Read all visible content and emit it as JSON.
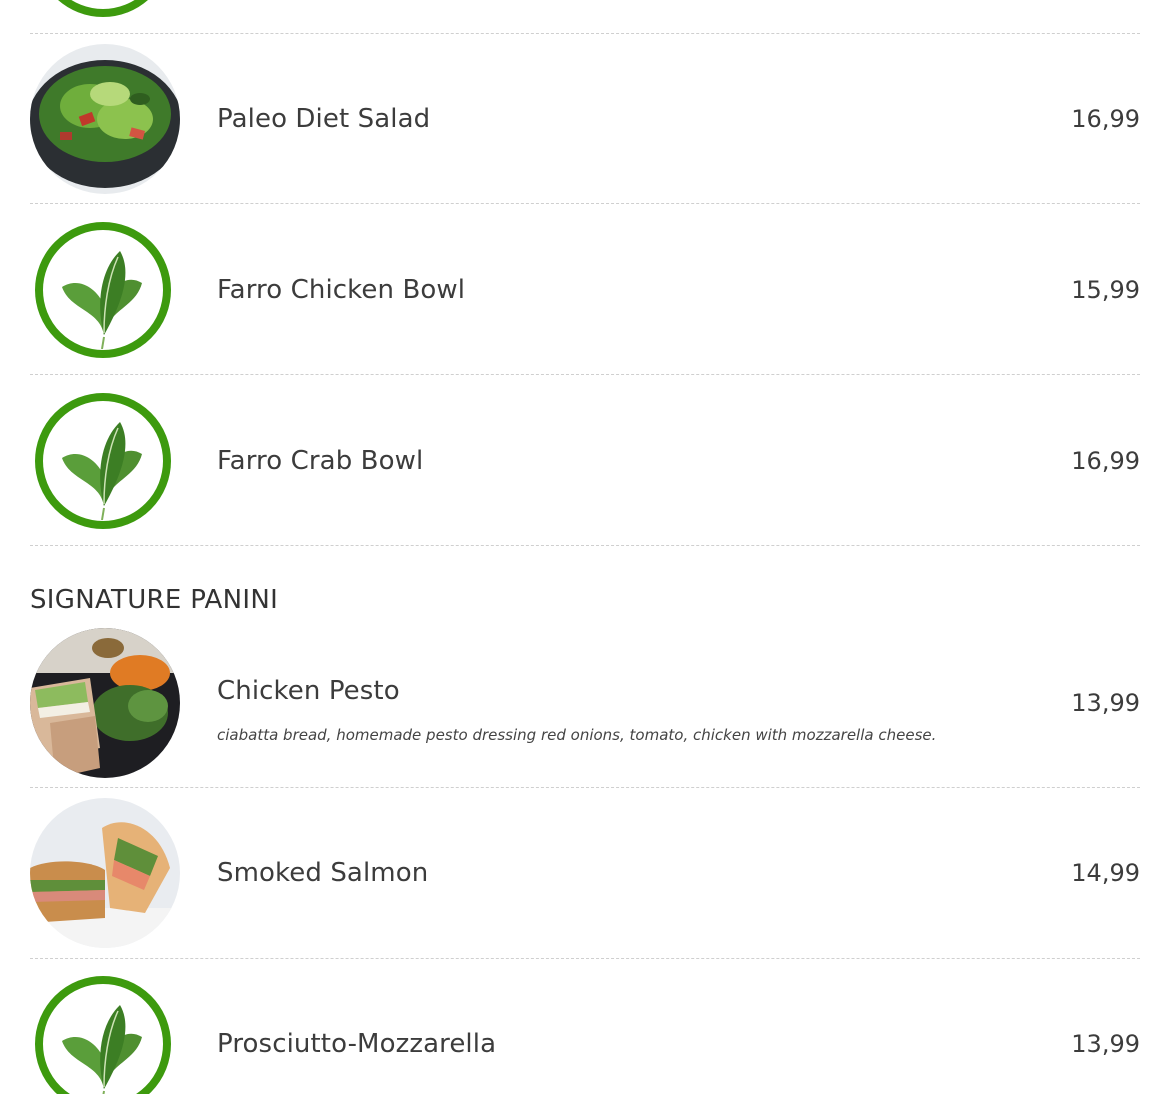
{
  "colors": {
    "badge_green": "#3d9a0e",
    "divider": "#cfcfcf",
    "text": "#3c3c3c"
  },
  "items_top": [
    {
      "name": "Paleo Diet Salad",
      "price": "16,99",
      "image": "salad-photo"
    },
    {
      "name": "Farro Chicken Bowl",
      "price": "15,99",
      "image": "leaf-badge-icon"
    },
    {
      "name": "Farro Crab Bowl",
      "price": "16,99",
      "image": "leaf-badge-icon"
    }
  ],
  "section": {
    "title": "SIGNATURE PANINI"
  },
  "items_panini": [
    {
      "name": "Chicken Pesto",
      "description": "ciabatta bread, homemade pesto dressing red onions, tomato, chicken with mozzarella cheese.",
      "price": "13,99",
      "image": "panini-photo"
    },
    {
      "name": "Smoked Salmon",
      "price": "14,99",
      "image": "sandwich-photo"
    },
    {
      "name": "Prosciutto-Mozzarella",
      "price": "13,99",
      "image": "leaf-badge-icon"
    }
  ]
}
